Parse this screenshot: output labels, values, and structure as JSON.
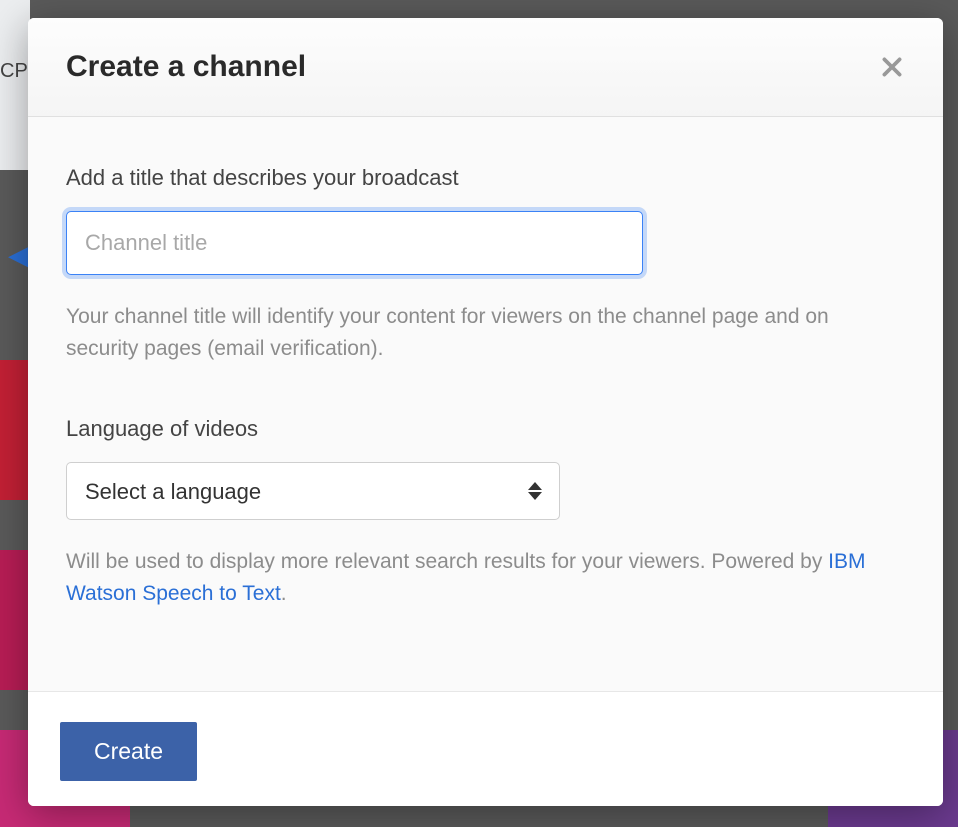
{
  "modal": {
    "title": "Create a channel",
    "title_field": {
      "label": "Add a title that describes your broadcast",
      "placeholder": "Channel title",
      "value": "",
      "helper": "Your channel title will identify your content for viewers on the channel page and on security pages (email verification)."
    },
    "language_field": {
      "label": "Language of videos",
      "selected": "Select a language",
      "helper_prefix": "Will be used to display more relevant search results for your viewers. Powered by ",
      "helper_link_text": "IBM Watson Speech to Text",
      "helper_suffix": "."
    },
    "footer": {
      "create_label": "Create"
    }
  },
  "background": {
    "partial_text": "CP"
  }
}
